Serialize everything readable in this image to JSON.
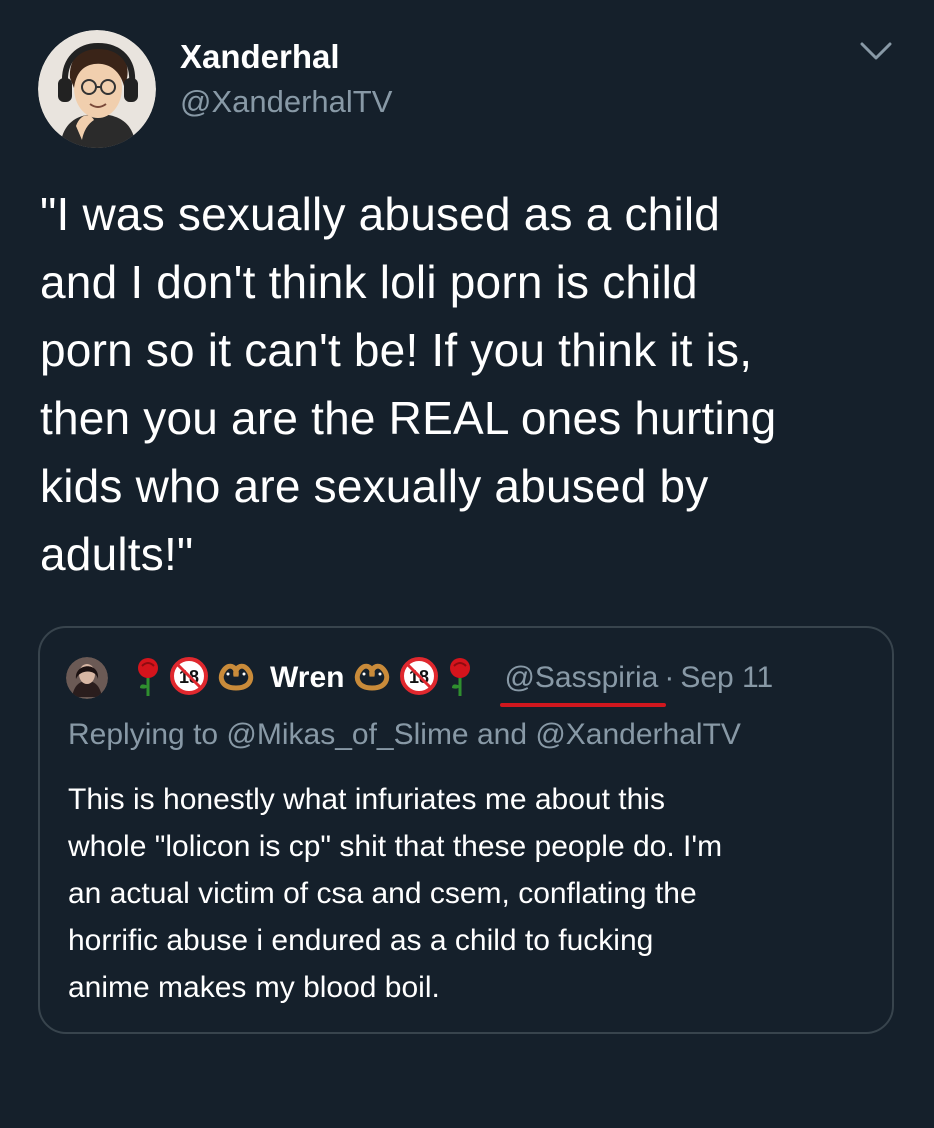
{
  "tweet": {
    "author": {
      "display_name": "Xanderhal",
      "handle": "@XanderhalTV",
      "avatar_icon": "cartoon-man-headphones-avatar"
    },
    "menu_icon": "chevron-down-icon",
    "text_lines": [
      "\"I was sexually abused as a child",
      "and I don't think loli porn is child",
      "porn so it can't be! If you think it is,",
      "then you are the REAL ones hurting",
      "kids who are sexually abused by",
      "adults!\""
    ],
    "quoted": {
      "avatar_icon": "user-avatar",
      "badges_before_name": [
        "rose-emoji",
        "no-under-18-emoji",
        "pretzel-emoji"
      ],
      "display_name": "Wren",
      "badges_after_name": [
        "pretzel-emoji",
        "no-under-18-emoji",
        "rose-emoji"
      ],
      "handle": "@Sasspiria",
      "separator": "·",
      "date": "Sep 11",
      "replying_to": "Replying to @Mikas_of_Slime and @XanderhalTV",
      "text_lines": [
        "This is honestly what infuriates me about this",
        "whole \"lolicon is cp\" shit that these people do. I'm",
        "an actual victim of csa and csem, conflating the",
        "horrific abuse i endured as a child to fucking",
        "anime makes my blood boil."
      ]
    }
  },
  "colors": {
    "background": "#15202b",
    "secondary_text": "#8899a6",
    "border": "#38444d",
    "handle_underline": "#d0171e"
  }
}
